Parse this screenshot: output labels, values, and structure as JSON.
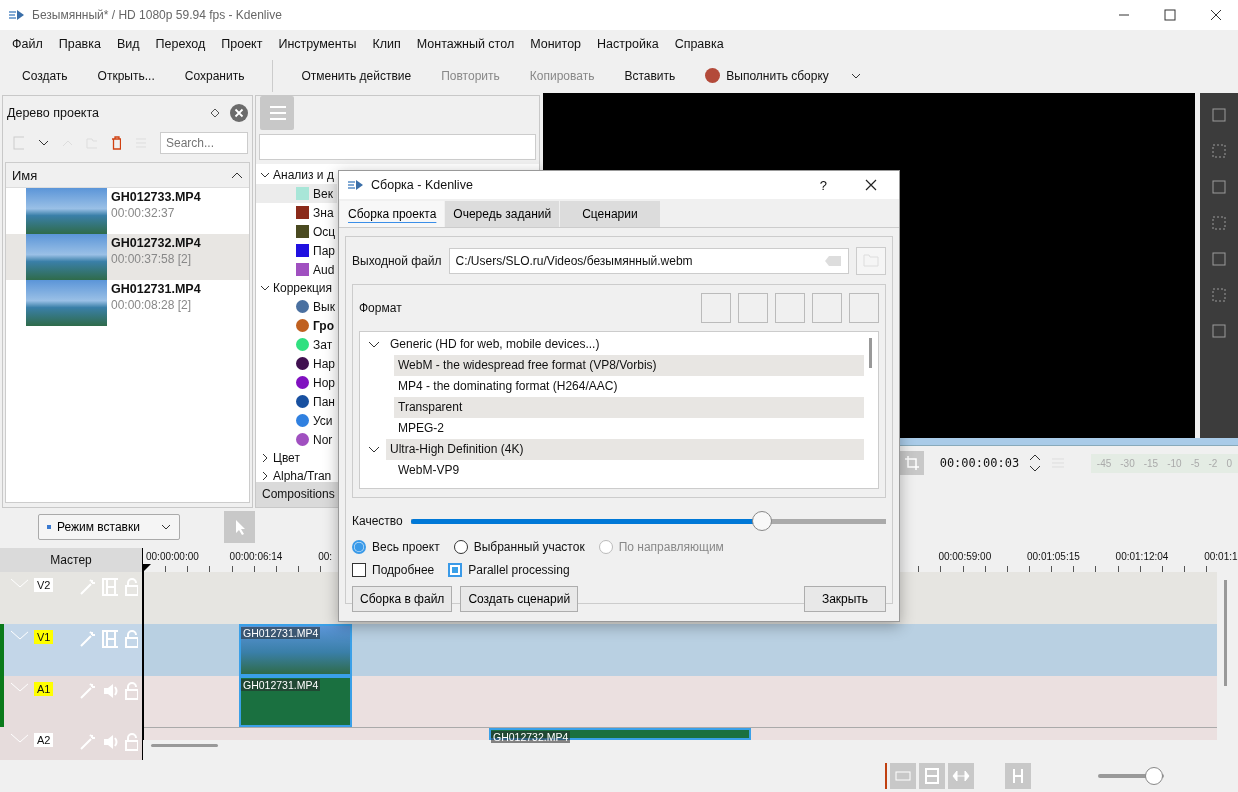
{
  "window": {
    "title": "Безымянный* / HD 1080p 59.94 fps - Kdenlive"
  },
  "menu": [
    "Файл",
    "Правка",
    "Вид",
    "Переход",
    "Проект",
    "Инструменты",
    "Клип",
    "Монтажный стол",
    "Монитор",
    "Настройка",
    "Справка"
  ],
  "toolbar": [
    {
      "label": "Создать",
      "disabled": false,
      "kind": "plain"
    },
    {
      "label": "Открыть...",
      "disabled": false,
      "kind": "plain"
    },
    {
      "label": "Сохранить",
      "disabled": false,
      "kind": "plain"
    },
    {
      "label": "Отменить действие",
      "disabled": false,
      "kind": "plain"
    },
    {
      "label": "Повторить",
      "disabled": true,
      "kind": "plain"
    },
    {
      "label": "Копировать",
      "disabled": true,
      "kind": "plain"
    },
    {
      "label": "Вставить",
      "disabled": false,
      "kind": "plain"
    },
    {
      "label": "Выполнить сборку",
      "disabled": false,
      "kind": "render"
    }
  ],
  "project_tree": {
    "title": "Дерево проекта",
    "search": {
      "placeholder": "Search..."
    },
    "column": "Имя",
    "clips": [
      {
        "name": "GH012733.MP4",
        "duration": "00:00:32:37",
        "selected": false
      },
      {
        "name": "GH012732.MP4",
        "duration": "00:00:37:58 [2]",
        "selected": true
      },
      {
        "name": "GH012731.MP4",
        "duration": "00:00:08:28 [2]",
        "selected": false
      }
    ]
  },
  "effects": {
    "tab": "Compositions",
    "groups": [
      {
        "label": "Анализ и д",
        "expanded": true,
        "children": [
          {
            "label": "Век",
            "color": "#a8e6d8",
            "kind": "square",
            "selected": true,
            "bold": false
          },
          {
            "label": "Зна",
            "color": "#8b2a1a",
            "kind": "square",
            "selected": false,
            "bold": false
          },
          {
            "label": "Осц",
            "color": "#4a4a20",
            "kind": "square",
            "selected": false,
            "bold": false
          },
          {
            "label": "Пар",
            "color": "#2010e0",
            "kind": "square",
            "selected": false,
            "bold": false
          },
          {
            "label": "Aud",
            "color": "#a050c0",
            "kind": "square",
            "selected": false,
            "bold": false
          }
        ]
      },
      {
        "label": "Коррекция",
        "expanded": true,
        "children": [
          {
            "label": "Вык",
            "color": "#4a70a0",
            "kind": "round",
            "selected": false,
            "bold": false
          },
          {
            "label": "Гро",
            "color": "#c06020",
            "kind": "round",
            "selected": false,
            "bold": true
          },
          {
            "label": "Зат",
            "color": "#30e080",
            "kind": "round",
            "selected": false,
            "bold": false
          },
          {
            "label": "Нар",
            "color": "#401050",
            "kind": "round",
            "selected": false,
            "bold": false
          },
          {
            "label": "Нор",
            "color": "#8010c0",
            "kind": "round",
            "selected": false,
            "bold": false
          },
          {
            "label": "Пан",
            "color": "#1850a0",
            "kind": "round",
            "selected": false,
            "bold": false
          },
          {
            "label": "Уси",
            "color": "#3080e0",
            "kind": "round",
            "selected": false,
            "bold": false
          },
          {
            "label": "Nor",
            "color": "#a050c0",
            "kind": "round",
            "selected": false,
            "bold": false
          }
        ]
      },
      {
        "label": "Цвет",
        "expanded": false
      },
      {
        "label": "Alpha/Tran",
        "expanded": false
      }
    ]
  },
  "monitor": {
    "timecode": "00:00:00:03",
    "meter_labels": [
      "-45",
      "-30",
      "-15",
      "-10",
      "-5",
      "-2",
      "0"
    ]
  },
  "edit_mode": {
    "label": "Режим вставки"
  },
  "timeline": {
    "master": "Мастер",
    "ruler": [
      "00:00:00:00",
      "00:00:06:14",
      "00:",
      "00:00:59:00",
      "00:01:05:15",
      "00:01:12:04",
      "00:01:1"
    ],
    "tracks": [
      {
        "name": "V2",
        "kind": "video",
        "target": false
      },
      {
        "name": "V1",
        "kind": "video",
        "target": true,
        "clips": [
          "GH012731.MP4"
        ]
      },
      {
        "name": "A1",
        "kind": "audio",
        "target": true,
        "clips": [
          "GH012731.MP4"
        ]
      },
      {
        "name": "A2",
        "kind": "audio",
        "target": false,
        "clips": [
          "GH012732.MP4"
        ]
      }
    ]
  },
  "zoom": {
    "level": 0.85
  },
  "dialog": {
    "title": "Сборка - Kdenlive",
    "help": "?",
    "tabs": [
      {
        "label": "Сборка проекта",
        "selected": true
      },
      {
        "label": "Очередь заданий",
        "selected": false
      },
      {
        "label": "Сценарии",
        "selected": false
      }
    ],
    "output_label": "Выходной файл",
    "output_value": "C:/Users/SLO.ru/Videos/безымянный.webm",
    "format_label": "Формат",
    "formats": [
      {
        "label": "Generic (HD for web, mobile devices...)",
        "expanded": true,
        "children": [
          "WebM - the widespread free format (VP8/Vorbis)",
          "MP4 - the dominating format (H264/AAC)",
          "Transparent",
          "MPEG-2"
        ]
      },
      {
        "label": "Ultra-High Definition (4K)",
        "expanded": true,
        "children": [
          "WebM-VP9"
        ]
      }
    ],
    "quality_label": "Качество",
    "quality": {
      "level": 0.74
    },
    "ranges": [
      {
        "label": "Весь проект",
        "selected": true,
        "disabled": false
      },
      {
        "label": "Выбранный участок",
        "selected": false,
        "disabled": false
      },
      {
        "label": "По направляющим",
        "selected": false,
        "disabled": true
      }
    ],
    "options": [
      {
        "label": "Подробнее",
        "checked": false
      },
      {
        "label": "Parallel processing",
        "checked": true
      }
    ],
    "buttons": [
      "Сборка в файл",
      "Создать сценарий"
    ],
    "close": "Закрыть"
  }
}
